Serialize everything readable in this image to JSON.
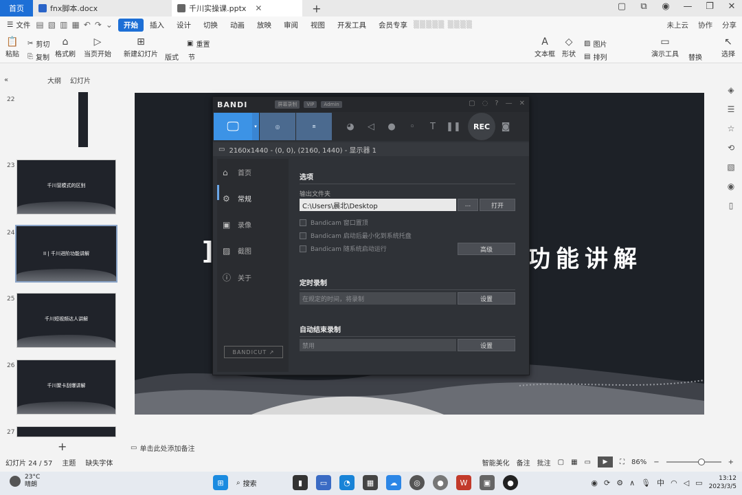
{
  "tabs": {
    "home": "首页",
    "doc1": "fnx脚本.docx",
    "doc2": "千川实操课.pptx"
  },
  "menu": {
    "file": "文件",
    "items": [
      "开始",
      "插入",
      "设计",
      "切换",
      "动画",
      "放映",
      "审阅",
      "视图",
      "开发工具",
      "会员专享"
    ],
    "right": [
      "未上云",
      "协作",
      "分享"
    ]
  },
  "ribbon": {
    "paste": "粘贴",
    "cut": "剪切",
    "copy": "复制",
    "format_painter": "格式刷",
    "play_current": "当页开始",
    "new_slide": "新建幻灯片",
    "layout": "版式",
    "section": "节",
    "reset": "重置",
    "textbox": "文本框",
    "shape": "形状",
    "arrange": "排列",
    "picture": "图片",
    "presentation_tools": "演示工具",
    "replace": "替换",
    "select": "选择"
  },
  "panel": {
    "outline_tab": "大纲",
    "slides_tab": "幻灯片",
    "thumbnails": [
      {
        "num": "22",
        "caption": ""
      },
      {
        "num": "23",
        "caption": "千川营模式的区别"
      },
      {
        "num": "24",
        "caption": "II | 千川进阶功能讲解"
      },
      {
        "num": "25",
        "caption": "千川短视频达人讲解"
      },
      {
        "num": "26",
        "caption": "千川聚卡刮爆讲解"
      },
      {
        "num": "27",
        "caption": ""
      }
    ]
  },
  "slide": {
    "visible_text": "功能讲解",
    "bracket": "]"
  },
  "notes_placeholder": "单击此处添加备注",
  "bandicam": {
    "logo": "BANDI",
    "badges": [
      "屏幕录制",
      "VIP",
      "Admin"
    ],
    "rec": "REC",
    "resolution_info": "2160x1440 - (0, 0), (2160, 1440) - 显示器 1",
    "nav": [
      "首页",
      "常规",
      "录像",
      "截图",
      "关于"
    ],
    "section_options": "选项",
    "output_folder_label": "输出文件夹",
    "output_path": "C:\\Users\\晨北\\Desktop",
    "browse": "...",
    "open": "打开",
    "checkbox1": "Bandicam 窗口置顶",
    "checkbox2": "Bandicam 启动后最小化到系统托盘",
    "checkbox3": "Bandicam 随系统启动运行",
    "advanced": "高级",
    "section_timer": "定时录制",
    "timer_value": "在规定的时间，将录制",
    "timer_settings": "设置",
    "section_autostop": "自动结束录制",
    "autostop_value": "禁用",
    "autostop_settings": "设置",
    "bandicut": "BANDICUT ↗"
  },
  "status": {
    "slide_count": "幻灯片 24 / 57",
    "theme": "主题",
    "missing_fonts": "缺失字体",
    "smart_beautify": "智能美化",
    "notes": "备注",
    "comments": "批注",
    "zoom": "86%",
    "zoom_level": 0.65
  },
  "taskbar": {
    "temp": "23°C",
    "weather": "晴朗",
    "search": "搜索",
    "time": "13:12",
    "date": "2023/3/5",
    "ime": "中"
  },
  "colors": {
    "accent": "#1d6fd6",
    "bandicam_blue": "#3c93e6",
    "slide_bg": "#1d2127"
  }
}
